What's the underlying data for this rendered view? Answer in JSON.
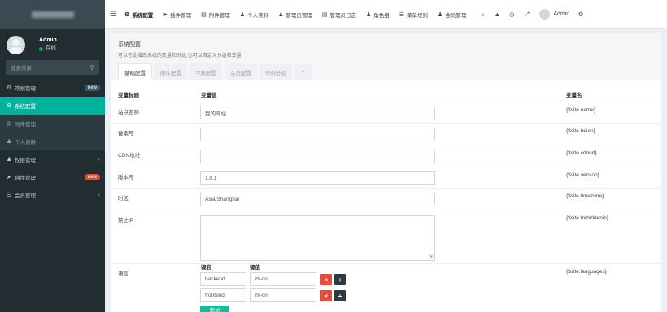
{
  "sidebar": {
    "user": {
      "name": "Admin",
      "status": "在线"
    },
    "search_placeholder": "搜索菜单",
    "items": [
      {
        "icon": "cogs-icon",
        "label": "常规管理",
        "badge": "new"
      },
      {
        "icon": "cog-icon",
        "label": "系统配置"
      },
      {
        "icon": "folder-icon",
        "label": "附件管理"
      },
      {
        "icon": "user-icon",
        "label": "个人资料"
      },
      {
        "icon": "group-icon",
        "label": "权限管理"
      },
      {
        "icon": "rocket-icon",
        "label": "插件管理",
        "badge": "new"
      },
      {
        "icon": "list-icon",
        "label": "会员管理"
      }
    ]
  },
  "topnav": {
    "items": [
      {
        "icon": "cog-icon",
        "label": "系统配置"
      },
      {
        "icon": "rocket-icon",
        "label": "插件管理"
      },
      {
        "icon": "folder-icon",
        "label": "附件管理"
      },
      {
        "icon": "user-icon",
        "label": "个人资料"
      },
      {
        "icon": "user-icon",
        "label": "管理员管理"
      },
      {
        "icon": "list-icon",
        "label": "管理员日志"
      },
      {
        "icon": "group-icon",
        "label": "角色组"
      },
      {
        "icon": "list-icon",
        "label": "菜单规则"
      },
      {
        "icon": "user-icon",
        "label": "会员管理"
      }
    ],
    "admin": "Admin"
  },
  "panel": {
    "title": "系统配置",
    "subtitle": "可以在此增改系统的变量和分组,也可以自定义分组和变量",
    "tabs": [
      "基础配置",
      "邮件配置",
      "字典配置",
      "会员配置",
      "示例分组",
      "+"
    ]
  },
  "table": {
    "headers": {
      "title": "变量标题",
      "value": "变量值",
      "var": "变量名"
    },
    "rows": [
      {
        "title": "站点名称",
        "value": "我的网站",
        "var": "{$site.name}"
      },
      {
        "title": "备案号",
        "value": "",
        "var": "{$site.beian}"
      },
      {
        "title": "CDN地址",
        "value": "",
        "var": "{$site.cdnurl}"
      },
      {
        "title": "版本号",
        "value": "1.0.1",
        "var": "{$site.version}"
      },
      {
        "title": "时区",
        "value": "Asia/Shanghai",
        "var": "{$site.timezone}"
      },
      {
        "title": "禁止IP",
        "value": "",
        "var": "{$site.forbiddenip}"
      },
      {
        "title": "语言",
        "value": "",
        "var": "{$site.languages}"
      }
    ],
    "languages": {
      "key_header": "键名",
      "val_header": "键值",
      "pairs": [
        {
          "key": "backend",
          "value": "zh-cn"
        },
        {
          "key": "frontend",
          "value": "zh-cn"
        }
      ],
      "append_label": "追加"
    }
  }
}
